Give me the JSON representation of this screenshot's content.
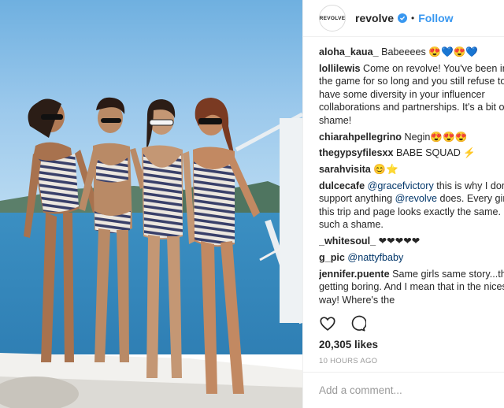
{
  "post": {
    "account": "revolve",
    "avatar_text": "REVOLVE",
    "follow_label": "Follow",
    "separator": "•",
    "likes": "20,305 likes",
    "time": "10 HOURS AGO",
    "add_comment_placeholder": "Add a comment..."
  },
  "comments": [
    {
      "user": "aloha_kaua_",
      "text": " Babeeees ",
      "emoji": [
        "smiling-face-with-heart-eyes",
        "blue-heart",
        "smiling-face-with-heart-eyes",
        "blue-heart"
      ]
    },
    {
      "user": "lollilewis",
      "text": " Come on revolve! You've been in the game for so long and you still refuse to have some diversity in your influencer collaborations and partnerships. It's a bit of a shame!"
    },
    {
      "user": "chiarahpellegrino",
      "text": " Negin",
      "emoji": [
        "smiling-face-with-heart-eyes",
        "smiling-face-with-heart-eyes",
        "smiling-face-with-heart-eyes"
      ]
    },
    {
      "user": "thegypsyfilesxx",
      "text": " BABE SQUAD ",
      "emoji": [
        "lightning"
      ]
    },
    {
      "user": "sarahvisita",
      "text": " ",
      "emoji": [
        "smiling-face",
        "star"
      ]
    },
    {
      "user": "dulcecafe",
      "mention": "@gracefvictory",
      "text": " this is why I don't support anything ",
      "mention2": "@revolve",
      "text2": " does. Every girl on this trip and page looks exactly the same. It's such a shame."
    },
    {
      "user": "_whitesoul_",
      "text": " ❤❤❤❤❤"
    },
    {
      "user": "g_pic",
      "mention": "@nattyfbaby"
    },
    {
      "user": "jennifer.puente",
      "text": " Same girls same story...this is getting boring. And I mean that in the nicest way! Where's the"
    }
  ],
  "colors": {
    "link": "#3897f0",
    "mention": "#003569",
    "muted": "#999999",
    "text": "#262626"
  }
}
